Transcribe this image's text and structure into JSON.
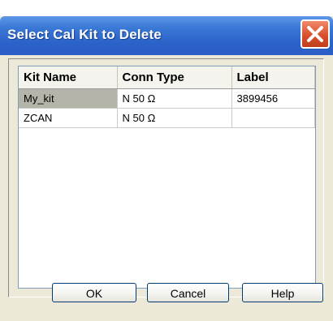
{
  "window": {
    "title": "Select Cal Kit to Delete"
  },
  "table": {
    "columns": [
      "Kit Name",
      "Conn Type",
      "Label"
    ],
    "rows": [
      [
        "My_kit",
        "N 50 Ω",
        "3899456"
      ],
      [
        "ZCAN",
        "N 50 Ω",
        ""
      ]
    ],
    "selected_row": 0
  },
  "buttons": {
    "ok": "OK",
    "cancel": "Cancel",
    "help": "Help"
  },
  "icons": {
    "close": "close-icon"
  },
  "colors": {
    "titlebar": "#2b62c9",
    "close_button": "#d8502b",
    "selection": "#b4b4a8"
  }
}
